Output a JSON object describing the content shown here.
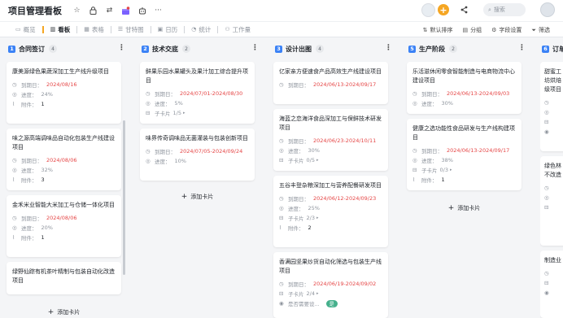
{
  "title": "项目管理看板",
  "search_placeholder": "搜索",
  "views": [
    {
      "label": "概览",
      "icon": "▭"
    },
    {
      "label": "看板",
      "icon": "▥"
    },
    {
      "label": "表格",
      "icon": "▦"
    },
    {
      "label": "甘特图",
      "icon": "☰"
    },
    {
      "label": "日历",
      "icon": "▣"
    },
    {
      "label": "统计",
      "icon": "◔"
    },
    {
      "label": "工作量",
      "icon": "⚇"
    }
  ],
  "toolbar": {
    "sort": "默认排序",
    "group": "分组",
    "fields": "字段设置",
    "filter": "筛选"
  },
  "labels": {
    "due": "到期日：",
    "progress": "进度：",
    "attach": "附件：",
    "subcard": "子卡片",
    "add": "添加卡片"
  },
  "columns": [
    {
      "num": "1",
      "color": "#3b82f6",
      "name": "合同签订",
      "count": "4",
      "cards": [
        {
          "title": "康美源绿色果蔬深加工生产线升级项目",
          "due": "2024/08/16",
          "progress": "24%",
          "attach": "1"
        },
        {
          "title": "味之源高端调味品自动化包装生产线建设项目",
          "due": "2024/08/06",
          "progress": "32%",
          "attach": "3"
        },
        {
          "title": "金禾米业智能大米加工与仓储一体化项目",
          "due": "2024/08/06",
          "progress": "20%",
          "attach": "1"
        },
        {
          "title": "绿野仙踪有机茶叶精制与包装自动化改造项目"
        }
      ]
    },
    {
      "num": "2",
      "color": "#3b82f6",
      "name": "技术交底",
      "count": "2",
      "cards": [
        {
          "title": "鲜果乐园水果罐头及果汁加工综合提升项目",
          "due": "2024/07/01-2024/08/30",
          "progress": "5%",
          "sub": "1/5"
        },
        {
          "title": "味界传奇调味品无菌灌装与包装创新项目",
          "due": "2024/07/05-2024/09/24",
          "progress": "10%"
        }
      ]
    },
    {
      "num": "3",
      "color": "#3b82f6",
      "name": "设计出图",
      "count": "4",
      "cards": [
        {
          "title": "亿家亲方便速食产品高效生产线建设项目",
          "due": "2024/06/13-2024/09/17"
        },
        {
          "title": "海蓝之恋海洋食品深加工与保鲜技术研发项目",
          "due": "2024/06/23-2024/10/11",
          "progress": "30%",
          "sub": "0/5"
        },
        {
          "title": "五谷丰登杂粮深加工与营养配餐研发项目",
          "due": "2024/06/12-2024/09/23",
          "progress": "25%",
          "sub": "2/3",
          "attach": "2"
        },
        {
          "title": "香满园坚果炒货自动化筛选与包装生产线项目",
          "due": "2024/06/19-2024/09/02",
          "sub": "2/4",
          "extra": "是否需要设...",
          "tag": "是"
        }
      ]
    },
    {
      "num": "5",
      "color": "#3b82f6",
      "name": "生产阶段",
      "count": "2",
      "cards": [
        {
          "title": "乐活滋休闲零食智能制造与电商物流中心建设项目",
          "due": "2024/06/13-2024/09/03",
          "progress": "30%"
        },
        {
          "title": "健康之选功能性食品研发与生产线构建项目",
          "due": "2024/06/13-2024/09/17",
          "progress": "38%",
          "sub": "0/3",
          "attach": "1"
        }
      ]
    },
    {
      "num": "6",
      "color": "#3b82f6",
      "name": "订单",
      "cards": [
        {
          "title": "甜蜜工坊烘焙级项目"
        },
        {
          "title": "绿色林不改造"
        },
        {
          "title": "制造业"
        }
      ]
    }
  ]
}
